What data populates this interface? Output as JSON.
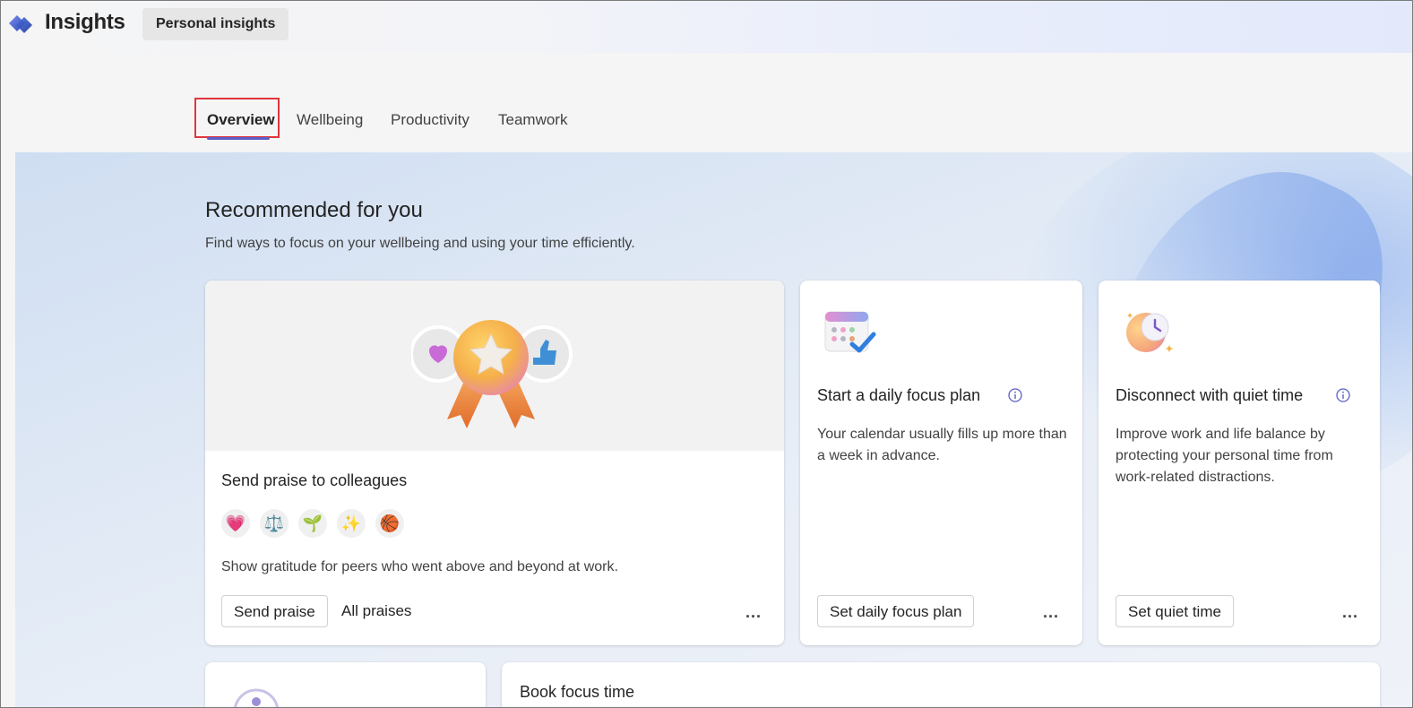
{
  "app": {
    "title": "Insights",
    "tab": "Personal insights"
  },
  "tabs": [
    {
      "label": "Overview"
    },
    {
      "label": "Wellbeing"
    },
    {
      "label": "Productivity"
    },
    {
      "label": "Teamwork"
    }
  ],
  "section": {
    "title": "Recommended for you",
    "subtitle": "Find ways to focus on your wellbeing and using your time efficiently."
  },
  "cards": {
    "praise": {
      "title": "Send praise to colleagues",
      "emojis": [
        "💗",
        "⚖️",
        "🌱",
        "✨",
        "🏀"
      ],
      "description": "Show gratitude for peers who went above and beyond at work.",
      "primary_button": "Send praise",
      "secondary_button": "All praises",
      "more": "..."
    },
    "focus_plan": {
      "title": "Start a daily focus plan",
      "description": "Your calendar usually fills up more than a week in advance.",
      "button": "Set daily focus plan",
      "more": "..."
    },
    "quiet_time": {
      "title": "Disconnect with quiet time",
      "description": "Improve work and life balance by protecting your personal time from work-related distractions.",
      "button": "Set quiet time",
      "more": "..."
    },
    "book_focus": {
      "title": "Book focus time"
    }
  },
  "colors": {
    "accent": "#5b5fc7",
    "highlight": "#e0353d"
  }
}
